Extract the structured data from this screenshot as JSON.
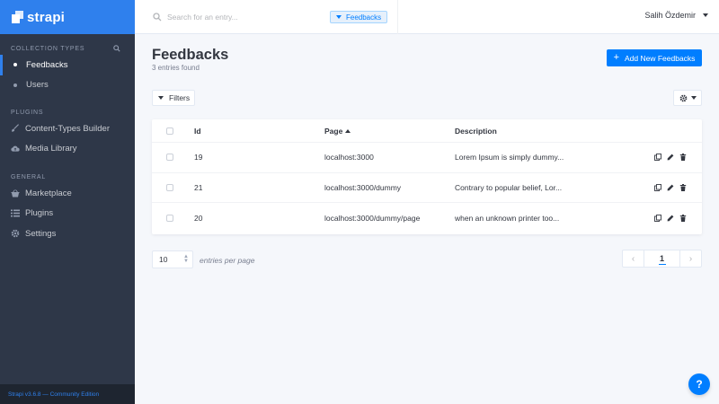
{
  "brand": {
    "name": "strapi",
    "accent": "#2f80ed",
    "primary": "#007eff"
  },
  "sidebar": {
    "sections": [
      {
        "title": "Collection Types",
        "icon": "search-icon"
      },
      {
        "title": "Plugins"
      },
      {
        "title": "General"
      }
    ],
    "collection_items": [
      {
        "label": "Feedbacks",
        "active": true
      },
      {
        "label": "Users",
        "active": false
      }
    ],
    "plugin_items": [
      {
        "label": "Content-Types Builder",
        "icon": "paintbrush-icon"
      },
      {
        "label": "Media Library",
        "icon": "cloud-upload-icon"
      }
    ],
    "general_items": [
      {
        "label": "Marketplace",
        "icon": "shopping-basket-icon"
      },
      {
        "label": "Plugins",
        "icon": "list-icon"
      },
      {
        "label": "Settings",
        "icon": "gear-icon"
      }
    ],
    "footer": "Strapi v3.6.8 — Community Edition"
  },
  "header": {
    "search_placeholder": "Search for an entry...",
    "filter_tag": "Feedbacks",
    "user_name": "Salih Özdemir"
  },
  "main": {
    "title": "Feedbacks",
    "subtitle": "3 entries found",
    "add_button": "Add New Feedbacks",
    "filters_button": "Filters",
    "settings_icon": "gear-icon"
  },
  "table": {
    "columns": [
      "Id",
      "Page",
      "Description"
    ],
    "sorted_column": "Page",
    "sort_direction": "ascending",
    "rows": [
      {
        "id": "19",
        "page": "localhost:3000",
        "description": "Lorem Ipsum is simply dummy..."
      },
      {
        "id": "21",
        "page": "localhost:3000/dummy",
        "description": "Contrary to popular belief, Lor..."
      },
      {
        "id": "20",
        "page": "localhost:3000/dummy/page",
        "description": "when an unknown printer too..."
      }
    ],
    "row_actions": [
      "duplicate-icon",
      "pencil-icon",
      "trash-icon"
    ]
  },
  "footer_controls": {
    "per_page_value": "10",
    "per_page_label": "entries per page",
    "current_page": "1"
  },
  "help": {
    "label": "?"
  }
}
